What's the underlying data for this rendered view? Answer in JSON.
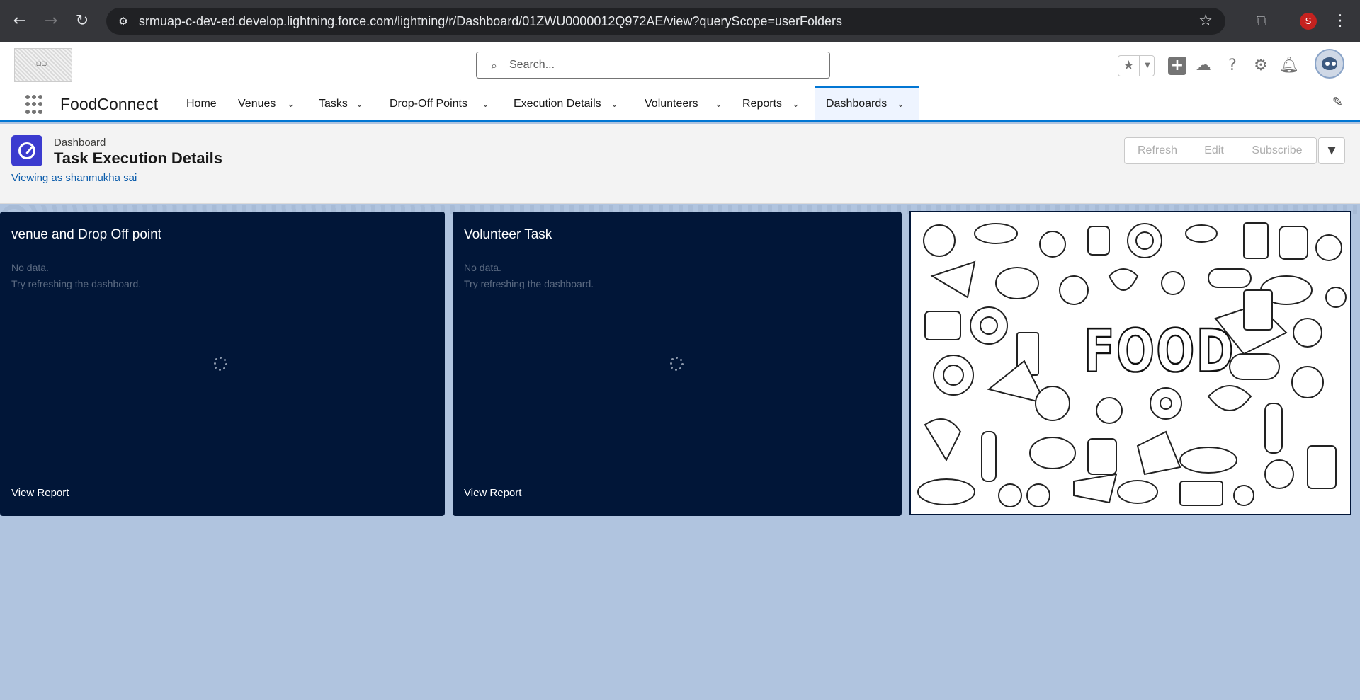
{
  "browser": {
    "url": "srmuap-c-dev-ed.develop.lightning.force.com/lightning/r/Dashboard/01ZWU0000012Q972AE/view?queryScope=userFolders",
    "profile_initial": "S"
  },
  "header": {
    "search_placeholder": "Search..."
  },
  "nav": {
    "app_name": "FoodConnect",
    "tabs": [
      {
        "label": "Home"
      },
      {
        "label": "Venues"
      },
      {
        "label": "Tasks"
      },
      {
        "label": "Drop-Off Points"
      },
      {
        "label": "Execution Details"
      },
      {
        "label": "Volunteers"
      },
      {
        "label": "Reports"
      },
      {
        "label": "Dashboards"
      }
    ]
  },
  "dashboard": {
    "eyebrow": "Dashboard",
    "title": "Task Execution Details",
    "viewing_as": "Viewing as shanmukha sai",
    "buttons": {
      "refresh": "Refresh",
      "edit": "Edit",
      "subscribe": "Subscribe"
    },
    "widgets": [
      {
        "title": "venue and Drop Off point",
        "no_data": "No data.",
        "hint": "Try refreshing the dashboard.",
        "link": "View Report"
      },
      {
        "title": "Volunteer Task",
        "no_data": "No data.",
        "hint": "Try refreshing the dashboard.",
        "link": "View Report"
      }
    ],
    "image_widget_text": "FOOD"
  },
  "colors": {
    "brand_blue": "#0176d3",
    "widget_bg": "#011638",
    "canvas_bg": "#b0c4df"
  }
}
